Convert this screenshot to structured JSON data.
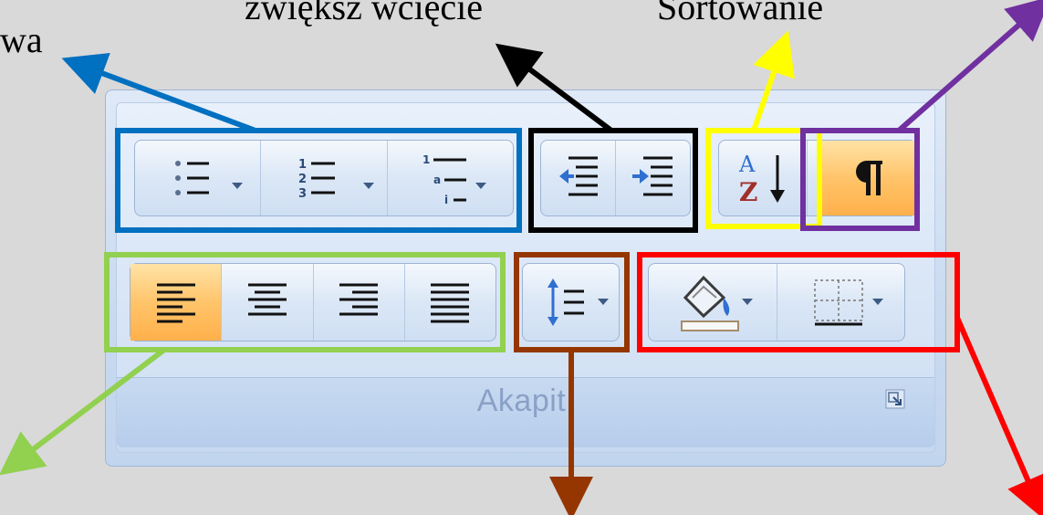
{
  "callouts": {
    "left_partial": "wa",
    "increase_indent_partial": "zwiększ wcięcie",
    "sort": "Sortowanie"
  },
  "ribbon": {
    "group_label": "Akapit"
  },
  "buttons": {
    "bullets": "Punktory",
    "numbering": "Numerowanie",
    "multilevel_list": "Lista wielopoziomowa",
    "decrease_indent": "Zmniejsz wcięcie",
    "increase_indent": "Zwiększ wcięcie",
    "sort": "Sortuj",
    "show_marks": "Pokaż wszystko",
    "align_left": "Wyrównaj do lewej",
    "center": "Wyśrodkuj",
    "align_right": "Wyrównaj do prawej",
    "justify": "Wyjustuj",
    "line_spacing": "Interlinia",
    "shading": "Cieniowanie",
    "borders": "Obramowanie"
  },
  "state": {
    "align_left_active": true,
    "show_marks_active": true
  },
  "colors": {
    "blue": "#0070c0",
    "black": "#000000",
    "yellow": "#ffff00",
    "purple": "#7030a0",
    "green": "#92d050",
    "brown": "#953600",
    "red": "#ff0000",
    "active_orange": "#ffb04a"
  }
}
